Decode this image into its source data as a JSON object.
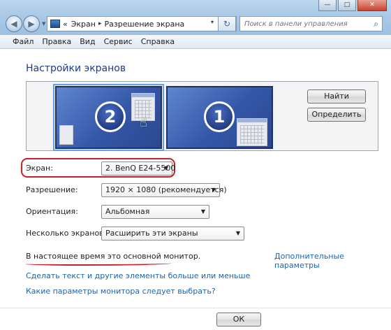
{
  "window": {
    "controls": {
      "minimize": "—",
      "maximize": "□",
      "close": "✕"
    }
  },
  "nav": {
    "back_icon": "◀",
    "forward_icon": "▶",
    "dropdown_icon": "▼",
    "refresh_icon": "↻"
  },
  "address": {
    "overflow": "«",
    "crumbs": [
      "Экран",
      "Разрешение экрана"
    ],
    "separator": "▸",
    "dropdown": "▾"
  },
  "search": {
    "placeholder": "Поиск в панели управления",
    "icon": "⌕"
  },
  "menu": [
    "Файл",
    "Правка",
    "Вид",
    "Сервис",
    "Справка"
  ],
  "page": {
    "title": "Настройки экранов"
  },
  "preview": {
    "monitors": [
      {
        "number": "2",
        "selected": true
      },
      {
        "number": "1",
        "selected": false
      }
    ],
    "cursor_icon": "☝"
  },
  "buttons": {
    "find": "Найти",
    "identify": "Определить",
    "ok": "ОК"
  },
  "settings": {
    "screen": {
      "label": "Экран:",
      "value": "2. BenQ E24-5500"
    },
    "resolution": {
      "label": "Разрешение:",
      "value": "1920 × 1080 (рекомендуется)"
    },
    "orientation": {
      "label": "Ориентация:",
      "value": "Альбомная"
    },
    "multiple": {
      "label": "Несколько экранов:",
      "value": "Расширить эти экраны"
    },
    "dropdown_arrow": "▼"
  },
  "status": {
    "text": "В настоящее время это основной монитор.",
    "advanced_link": "Дополнительные параметры"
  },
  "links": {
    "text_size": "Сделать текст и другие элементы больше или меньше",
    "which_settings": "Какие параметры монитора следует выбрать?"
  },
  "colors": {
    "title_blue": "#1f3a8a",
    "link_blue": "#1a64b0",
    "highlight_red": "#c6202a",
    "monitor_blue": "#3557a8"
  }
}
